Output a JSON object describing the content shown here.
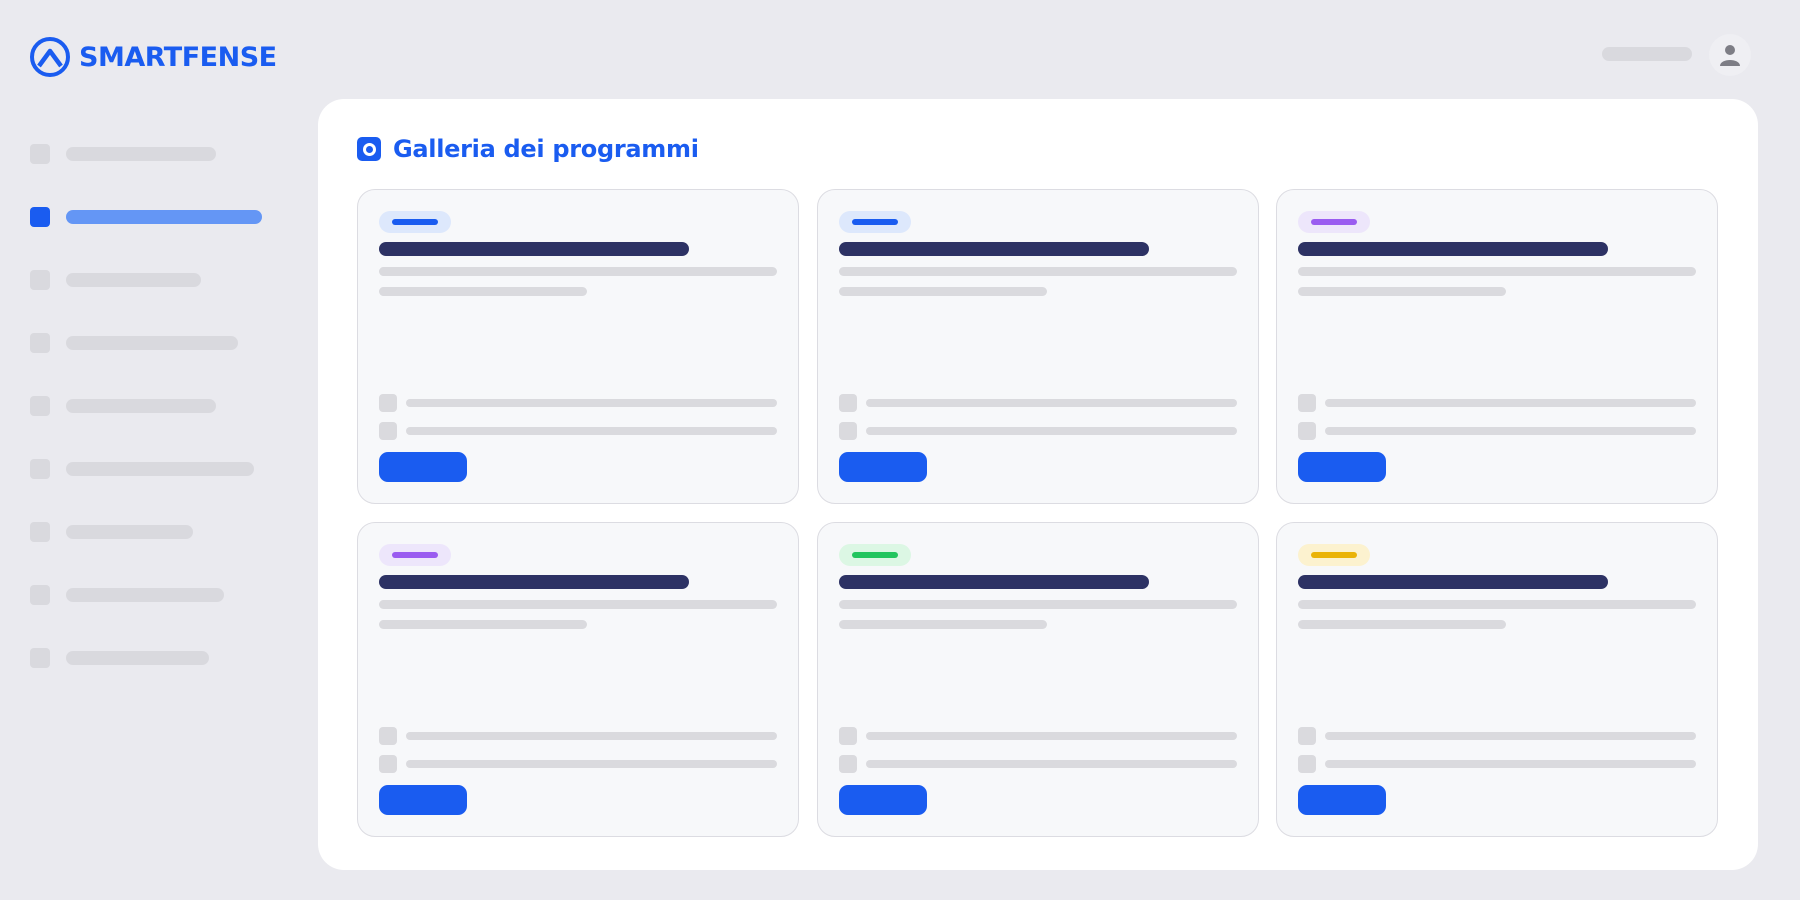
{
  "app": {
    "brand": "SMARTFENSE"
  },
  "header": {
    "user_icon": "user-icon"
  },
  "sidebar": {
    "active_index": 1,
    "items": [
      {
        "icon": "placeholder-icon"
      },
      {
        "icon": "placeholder-icon",
        "active": true
      },
      {
        "icon": "placeholder-icon"
      },
      {
        "icon": "placeholder-icon"
      },
      {
        "icon": "placeholder-icon"
      },
      {
        "icon": "placeholder-icon"
      },
      {
        "icon": "placeholder-icon"
      },
      {
        "icon": "placeholder-icon"
      },
      {
        "icon": "placeholder-icon"
      }
    ]
  },
  "main": {
    "title": "Galleria dei programmi",
    "title_icon": "gallery-icon",
    "cards": [
      {
        "tag_color": "blue"
      },
      {
        "tag_color": "blue"
      },
      {
        "tag_color": "purple"
      },
      {
        "tag_color": "purple"
      },
      {
        "tag_color": "green"
      },
      {
        "tag_color": "yellow"
      }
    ]
  },
  "colors": {
    "brand": "#1a5cf0",
    "background": "#eaeaef",
    "card_title": "#2d3264",
    "tag_blue": "#1a5cf0",
    "tag_purple": "#9a5cf0",
    "tag_green": "#22c55e",
    "tag_yellow": "#eab308"
  }
}
